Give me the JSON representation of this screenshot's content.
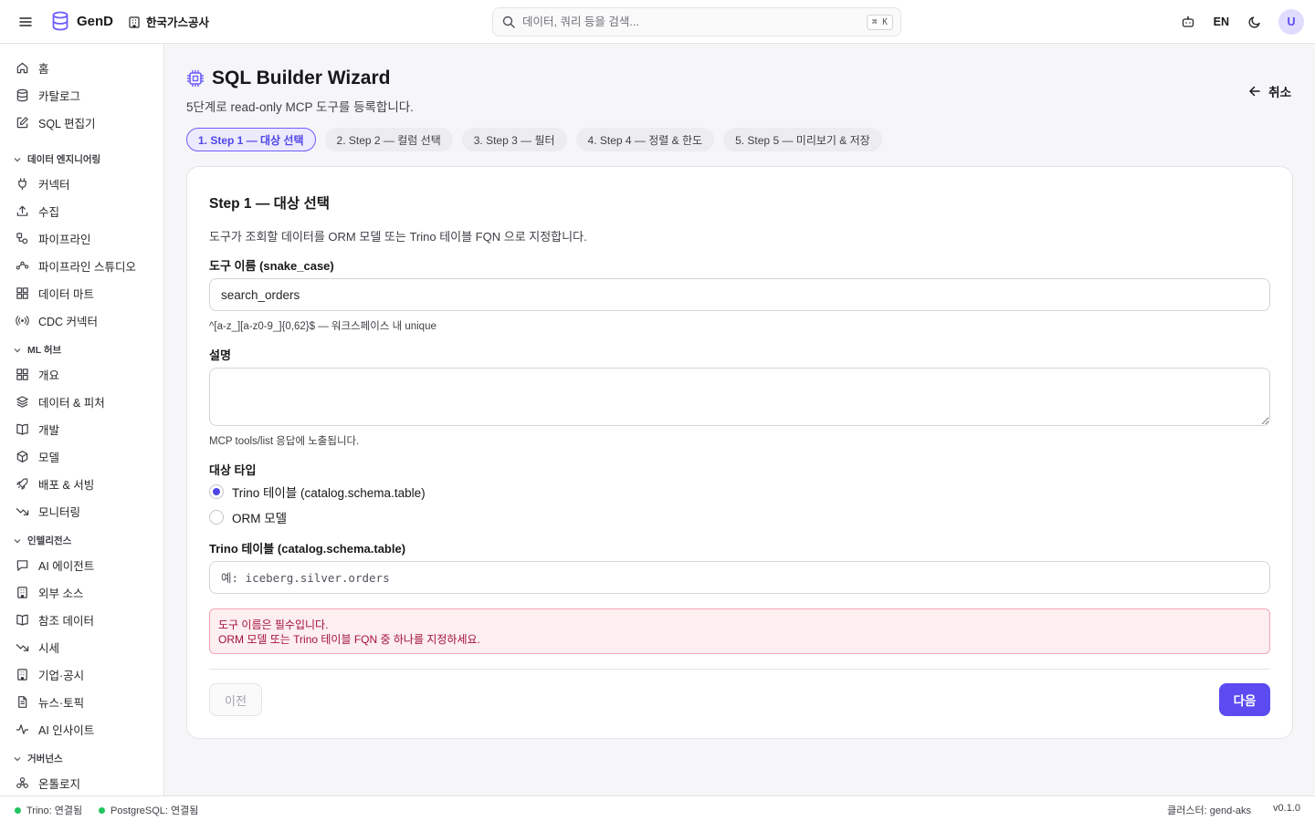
{
  "app": {
    "name": "GenD",
    "org": "한국가스공사"
  },
  "search": {
    "placeholder": "데이터, 쿼리 등을 검색...",
    "shortcut": "⌘ K"
  },
  "header": {
    "lang": "EN",
    "avatar_initial": "U"
  },
  "sidebar": {
    "top_items": [
      {
        "label": "홈",
        "icon": "home-icon"
      },
      {
        "label": "카탈로그",
        "icon": "database-icon"
      },
      {
        "label": "SQL 편집기",
        "icon": "edit-icon"
      }
    ],
    "sections": [
      {
        "title": "데이터 엔지니어링",
        "items": [
          {
            "label": "커넥터",
            "icon": "plug-icon"
          },
          {
            "label": "수집",
            "icon": "upload-icon"
          },
          {
            "label": "파이프라인",
            "icon": "pipeline-icon"
          },
          {
            "label": "파이프라인 스튜디오",
            "icon": "workflow-icon"
          },
          {
            "label": "데이터 마트",
            "icon": "grid-icon"
          },
          {
            "label": "CDC 커넥터",
            "icon": "radio-waves-icon"
          }
        ]
      },
      {
        "title": "ML 허브",
        "items": [
          {
            "label": "개요",
            "icon": "grid-icon"
          },
          {
            "label": "데이터 & 피처",
            "icon": "layers-icon"
          },
          {
            "label": "개발",
            "icon": "book-icon"
          },
          {
            "label": "모델",
            "icon": "cube-icon"
          },
          {
            "label": "배포 & 서빙",
            "icon": "rocket-icon"
          },
          {
            "label": "모니터링",
            "icon": "trend-down-icon"
          }
        ]
      },
      {
        "title": "인텔리전스",
        "items": [
          {
            "label": "AI 에이전트",
            "icon": "chat-icon"
          },
          {
            "label": "외부 소스",
            "icon": "building-icon"
          },
          {
            "label": "참조 데이터",
            "icon": "book-icon"
          },
          {
            "label": "시세",
            "icon": "trend-down-icon"
          },
          {
            "label": "기업·공시",
            "icon": "building-icon"
          },
          {
            "label": "뉴스·토픽",
            "icon": "document-icon"
          },
          {
            "label": "AI 인사이트",
            "icon": "activity-icon"
          }
        ]
      },
      {
        "title": "거버넌스",
        "items": [
          {
            "label": "온톨로지",
            "icon": "ontology-icon"
          }
        ]
      }
    ]
  },
  "page": {
    "title": "SQL Builder Wizard",
    "subtitle": "5단계로 read-only MCP 도구를 등록합니다.",
    "cancel_label": "취소",
    "steps": [
      {
        "label": "1. Step 1 — 대상 선택",
        "active": true
      },
      {
        "label": "2. Step 2 — 컬럼 선택",
        "active": false
      },
      {
        "label": "3. Step 3 — 필터",
        "active": false
      },
      {
        "label": "4. Step 4 — 정렬 & 한도",
        "active": false
      },
      {
        "label": "5. Step 5 — 미리보기 & 저장",
        "active": false
      }
    ]
  },
  "form": {
    "title": "Step 1 — 대상 선택",
    "description": "도구가 조회할 데이터를 ORM 모델 또는 Trino 테이블 FQN 으로 지정합니다.",
    "tool_name_label": "도구 이름 (snake_case)",
    "tool_name_value": "search_orders",
    "tool_name_hint": "^[a-z_][a-z0-9_]{0,62}$ — 워크스페이스 내 unique",
    "desc_label": "설명",
    "desc_value": "",
    "desc_hint": "MCP tools/list 응답에 노출됩니다.",
    "target_type_label": "대상 타입",
    "target_options": [
      {
        "label": "Trino 테이블 (catalog.schema.table)",
        "selected": true
      },
      {
        "label": "ORM 모델",
        "selected": false
      }
    ],
    "trino_label": "Trino 테이블 (catalog.schema.table)",
    "trino_placeholder": "예: iceberg.silver.orders",
    "errors": [
      "도구 이름은 필수입니다.",
      "ORM 모델 또는 Trino 테이블 FQN 중 하나를 지정하세요."
    ],
    "prev_label": "이전",
    "next_label": "다음"
  },
  "statusbar": {
    "trino": "Trino: 연결됨",
    "postgres": "PostgreSQL: 연결됨",
    "cluster": "클러스터: gend-aks",
    "version": "v0.1.0"
  },
  "colors": {
    "accent": "#5b4bf0",
    "status_ok": "#22c55e",
    "error_text": "#a3123a",
    "error_bg": "#fdeef0"
  }
}
